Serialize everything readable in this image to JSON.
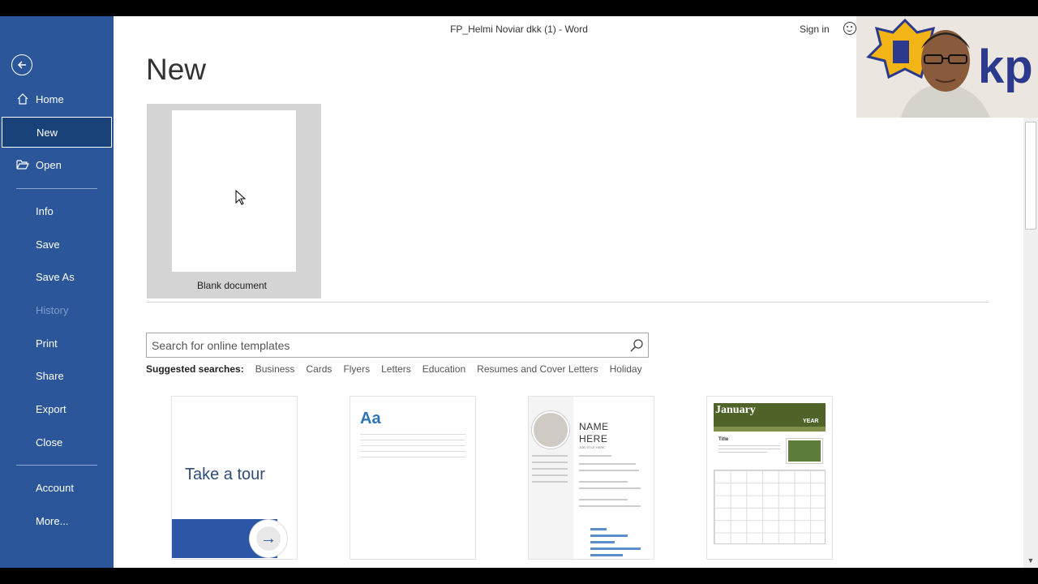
{
  "window": {
    "title": "FP_Helmi Noviar dkk (1)  -  Word",
    "sign_in": "Sign in"
  },
  "sidebar": {
    "items": [
      {
        "label": "Home",
        "icon": "home-icon"
      },
      {
        "label": "New",
        "icon": "new-document-icon",
        "active": true
      },
      {
        "label": "Open",
        "icon": "folder-open-icon"
      },
      {
        "label": "Info"
      },
      {
        "label": "Save"
      },
      {
        "label": "Save As"
      },
      {
        "label": "History",
        "disabled": true
      },
      {
        "label": "Print"
      },
      {
        "label": "Share"
      },
      {
        "label": "Export"
      },
      {
        "label": "Close"
      },
      {
        "label": "Account"
      },
      {
        "label": "More..."
      }
    ]
  },
  "main": {
    "title": "New",
    "blank_document_label": "Blank document",
    "search": {
      "placeholder": "Search for online templates",
      "value": ""
    },
    "suggested": {
      "heading": "Suggested searches:",
      "links": [
        "Business",
        "Cards",
        "Flyers",
        "Letters",
        "Education",
        "Resumes and Cover Letters",
        "Holiday"
      ]
    },
    "templates": {
      "tour_text": "Take a tour",
      "tour_arrow": "→",
      "aa_text": "Aa",
      "resume_name": "NAME HERE",
      "resume_subtitle": "JOB TITLE HERE",
      "calendar_month": "January",
      "calendar_year": "YEAR",
      "calendar_title": "Title"
    }
  },
  "colors": {
    "sidebar_bg": "#2b579a",
    "sidebar_active": "#19427a",
    "accent_blue": "#2e75b6",
    "calendar_green": "#4f6228"
  }
}
